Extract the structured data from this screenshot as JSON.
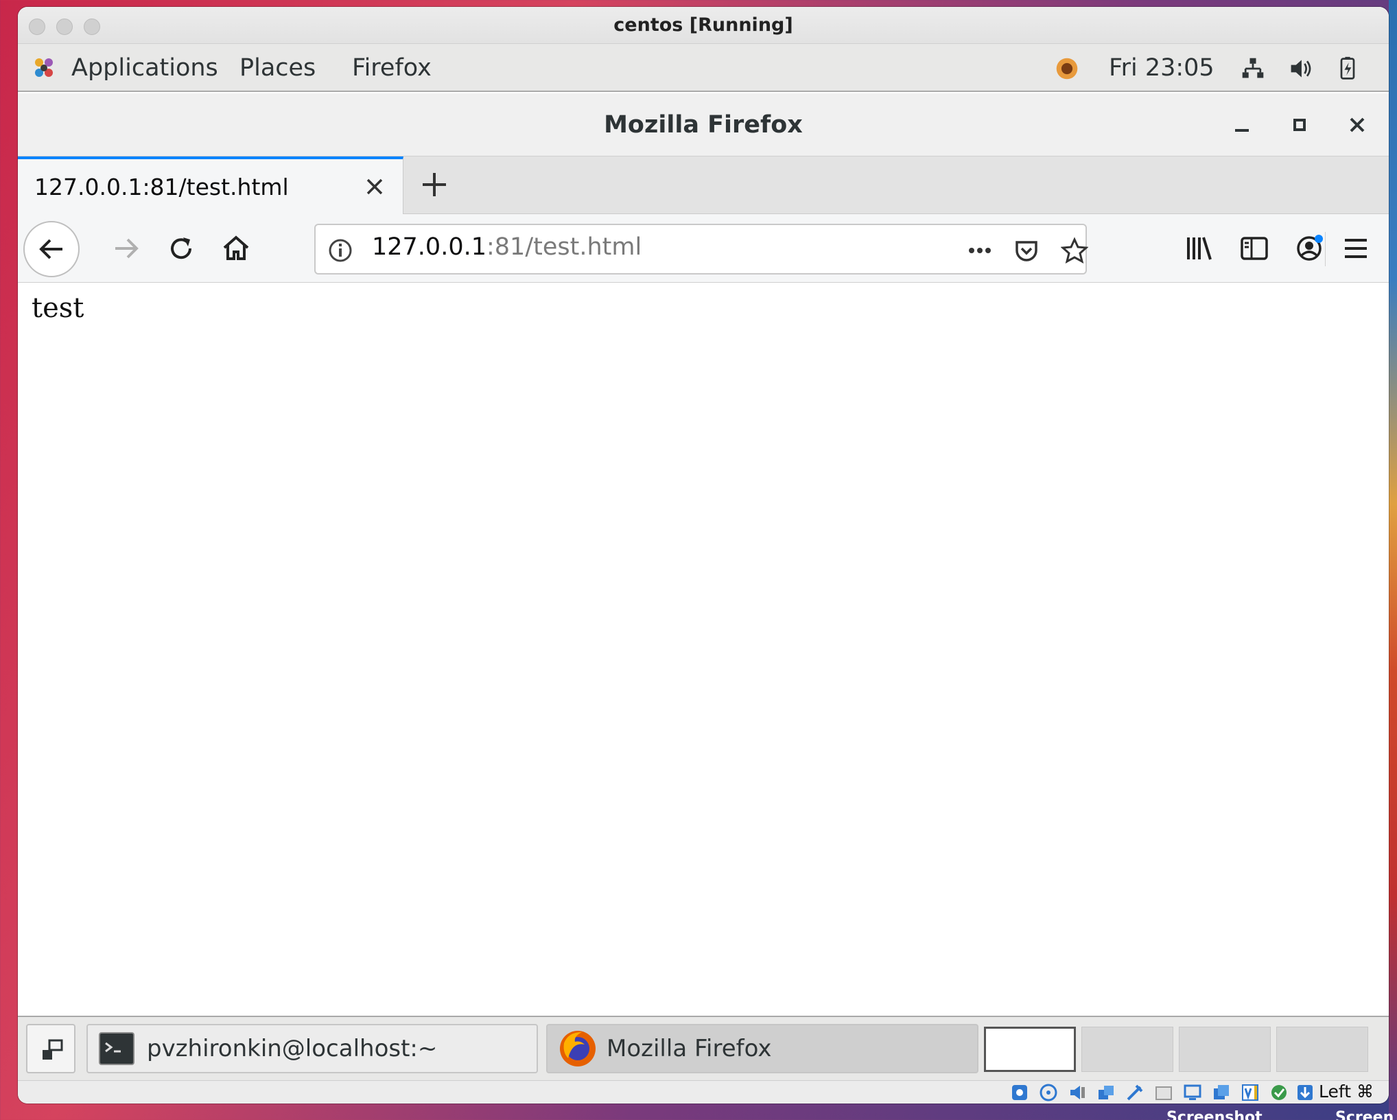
{
  "host": {
    "window_title": "centos [Running]",
    "host_key": "Left ⌘",
    "desktop_labels": [
      "Screenshot",
      "Screen"
    ]
  },
  "gnome_topbar": {
    "menus": [
      "Applications",
      "Places",
      "Firefox"
    ],
    "clock": "Fri 23:05"
  },
  "firefox": {
    "window_title": "Mozilla Firefox",
    "tab": {
      "label": "127.0.0.1:81/test.html"
    },
    "url": {
      "host": "127.0.0.1",
      "rest": ":81/test.html"
    },
    "accent": "#0a84ff"
  },
  "page": {
    "body_text": "test"
  },
  "taskbar": {
    "tasks": [
      "pvzhironkin@localhost:~",
      "Mozilla Firefox"
    ],
    "workspaces": 4,
    "active_workspace": 1
  }
}
